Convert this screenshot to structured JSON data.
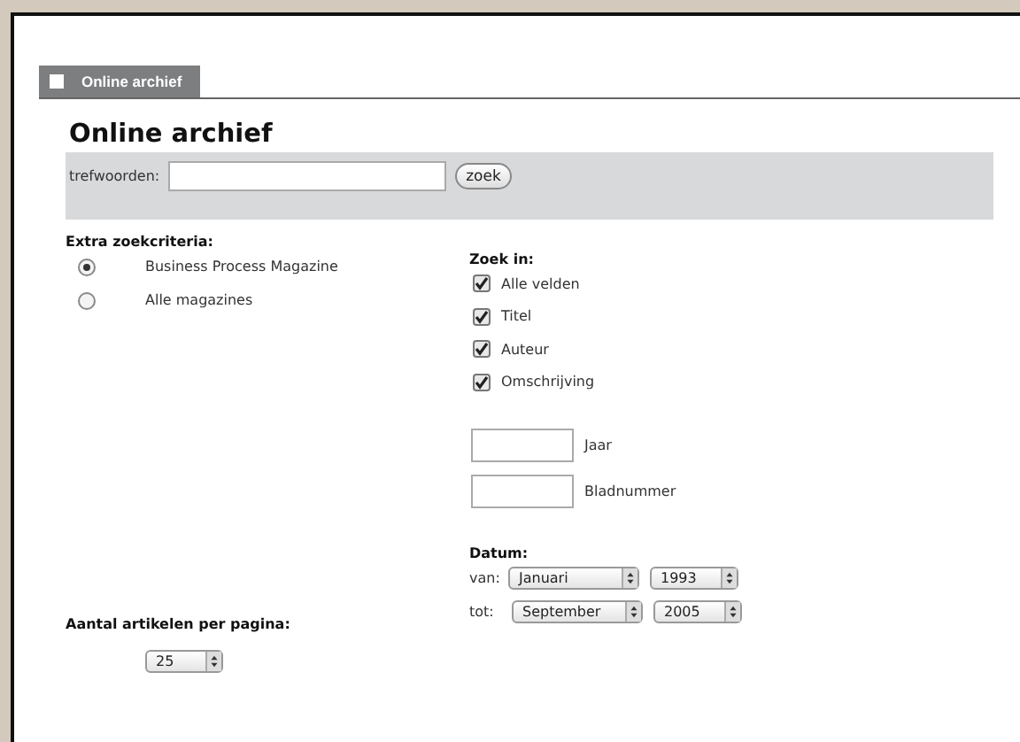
{
  "tab": {
    "label": "Online archief",
    "selected": true
  },
  "title": "Online archief",
  "search": {
    "label": "trefwoorden:",
    "button": "zoek"
  },
  "extra": {
    "heading": "Extra zoekcriteria:",
    "options": [
      {
        "label": "Business Process Magazine",
        "selected": true
      },
      {
        "label": "Alle magazines",
        "selected": false
      }
    ]
  },
  "zoek_in": {
    "heading": "Zoek in:",
    "fields": [
      {
        "label": "Alle velden",
        "checked": true
      },
      {
        "label": "Titel",
        "checked": true
      },
      {
        "label": "Auteur",
        "checked": true
      },
      {
        "label": "Omschrijving",
        "checked": true
      }
    ]
  },
  "number_fields": [
    {
      "label": "Jaar"
    },
    {
      "label": "Bladnummer"
    }
  ],
  "datum": {
    "heading": "Datum:",
    "rows": [
      {
        "label": "van:",
        "month": "Januari",
        "year": "1993"
      },
      {
        "label": "tot:",
        "month": "September",
        "year": "2005"
      }
    ]
  },
  "per_page": {
    "heading": "Aantal artikelen per pagina:",
    "value": "25"
  }
}
